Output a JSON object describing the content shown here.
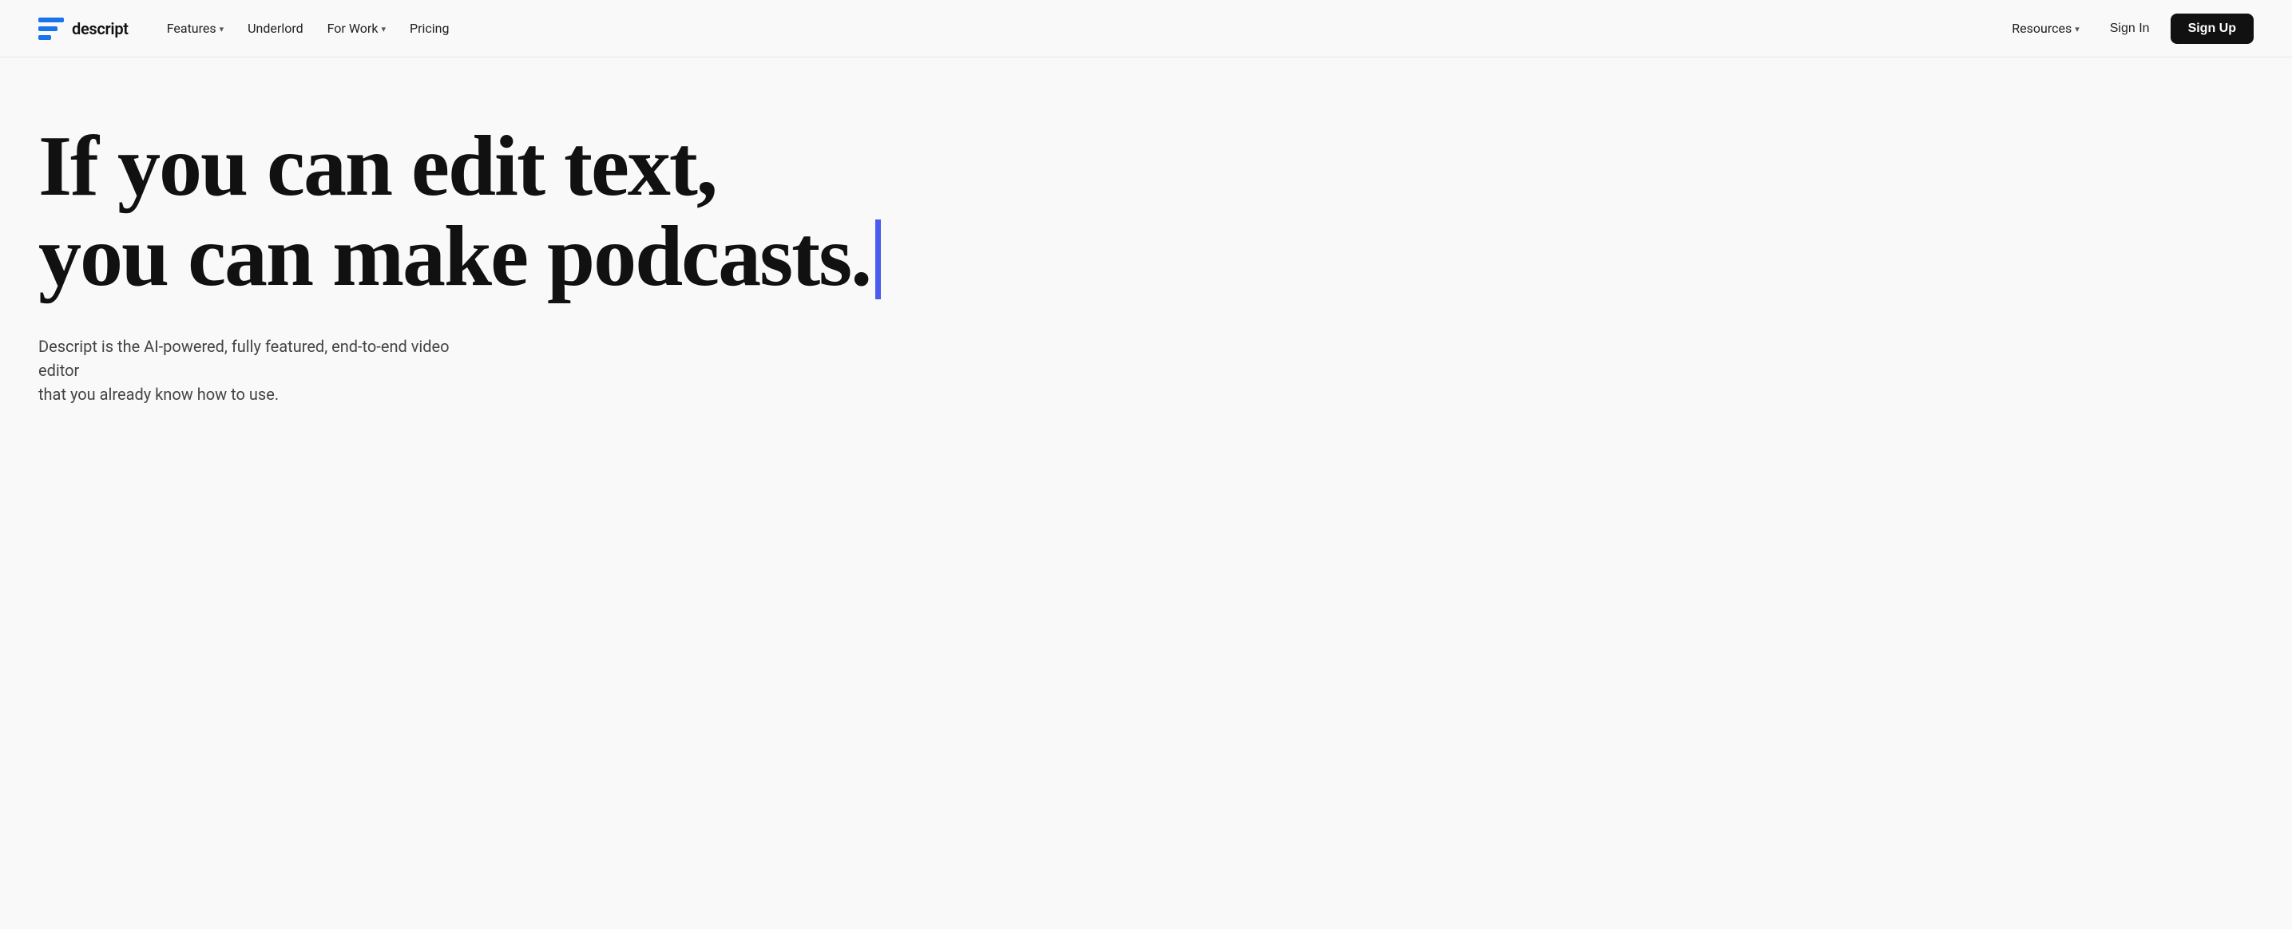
{
  "nav": {
    "logo": {
      "text": "descript"
    },
    "items": [
      {
        "label": "Features",
        "hasDropdown": true
      },
      {
        "label": "Underlord",
        "hasDropdown": false
      },
      {
        "label": "For Work",
        "hasDropdown": true
      },
      {
        "label": "Pricing",
        "hasDropdown": false
      }
    ],
    "rightItems": [
      {
        "label": "Resources",
        "hasDropdown": true
      }
    ],
    "signIn": "Sign In",
    "signUp": "Sign Up"
  },
  "hero": {
    "headline_line1": "If you can edit text,",
    "headline_line2": "you can make podcasts.",
    "subtext_line1": "Descript is the AI-powered, fully featured, end-to-end video editor",
    "subtext_line2": "that you already know how to use."
  }
}
